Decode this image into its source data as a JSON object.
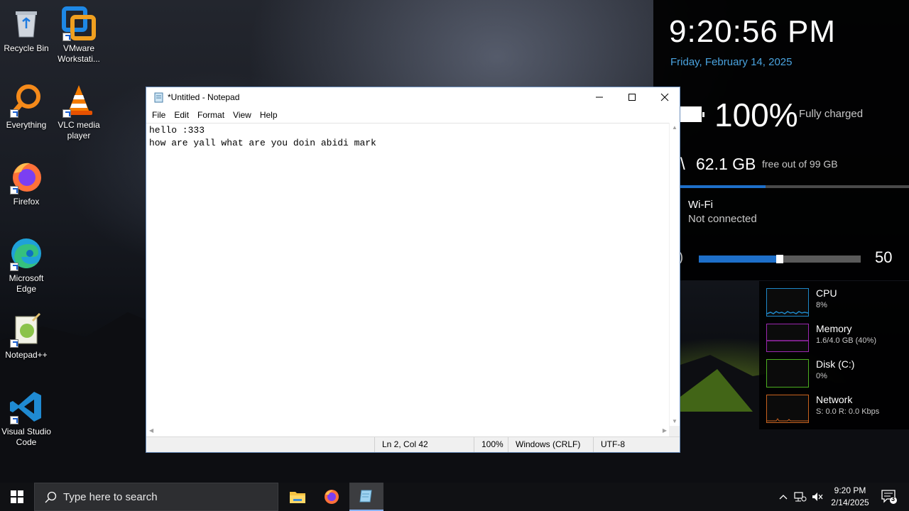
{
  "desktop": {
    "icons": [
      {
        "label": "Recycle Bin",
        "icon": "recycle-bin-icon"
      },
      {
        "label": "VMware\nWorkstati...",
        "icon": "vmware-icon"
      },
      {
        "label": "Everything",
        "icon": "everything-search-icon"
      },
      {
        "label": "VLC media\nplayer",
        "icon": "vlc-cone-icon"
      },
      {
        "label": "Firefox",
        "icon": "firefox-icon"
      },
      {
        "label": "Microsoft\nEdge",
        "icon": "edge-icon"
      },
      {
        "label": "Notepad++",
        "icon": "notepad-plus-plus-icon"
      },
      {
        "label": "Visual Studio\nCode",
        "icon": "vscode-icon"
      }
    ]
  },
  "notepad": {
    "title": "*Untitled - Notepad",
    "menu": [
      "File",
      "Edit",
      "Format",
      "View",
      "Help"
    ],
    "content": "hello :333\nhow are yall what are you doin abidi mark",
    "status": {
      "position": "Ln 2, Col 42",
      "zoom": "100%",
      "line_ending": "Windows (CRLF)",
      "encoding": "UTF-8"
    }
  },
  "widget": {
    "time": "9:20:56 PM",
    "date": "Friday, February 14, 2025",
    "battery": {
      "percent_text": "100%",
      "status": "Fully charged"
    },
    "disk": {
      "slash": "\\",
      "free": "62.1 GB",
      "label": "free out of 99 GB",
      "used_fraction": 0.373
    },
    "wifi": {
      "title": "Wi-Fi",
      "status": "Not connected"
    },
    "volume": {
      "value": 50,
      "label": "50"
    },
    "accent": "#1e6fc9",
    "date_color": "#4aa3df"
  },
  "perf": [
    {
      "name": "CPU",
      "value": "8%",
      "color": "#1e88c9"
    },
    {
      "name": "Memory",
      "value": "1.6/4.0 GB (40%)",
      "color": "#9b27b0"
    },
    {
      "name": "Disk (C:)",
      "value": "0%",
      "color": "#4caf20"
    },
    {
      "name": "Network",
      "value_s": "S: 0.0",
      "value_r": "R: 0.0 Kbps",
      "color": "#c8621e"
    }
  ],
  "taskbar": {
    "search_placeholder": "Type here to search",
    "clock_time": "9:20 PM",
    "clock_date": "2/14/2025",
    "notification_count": "3"
  }
}
